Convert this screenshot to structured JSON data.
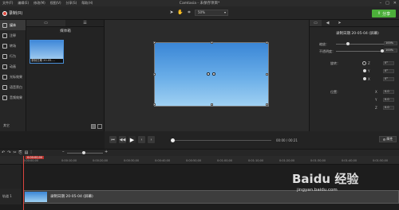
{
  "window": {
    "title": "Camtasia - 未保存项目*",
    "menus": [
      "文件(F)",
      "编辑(E)",
      "修改(M)",
      "视图(V)",
      "分享(S)",
      "帮助(H)"
    ]
  },
  "toolbar": {
    "record_label": "录制(R)",
    "zoom_value": "50%",
    "share_label": "分享"
  },
  "sidebar": {
    "items": [
      {
        "label": "媒体",
        "icon": "media-icon",
        "active": true
      },
      {
        "label": "注释",
        "icon": "annotation-icon"
      },
      {
        "label": "转场",
        "icon": "transition-icon"
      },
      {
        "label": "行为",
        "icon": "behavior-icon"
      },
      {
        "label": "动画",
        "icon": "animation-icon"
      },
      {
        "label": "光标效果",
        "icon": "cursor-effect-icon"
      },
      {
        "label": "语音旁白",
        "icon": "voice-narration-icon"
      },
      {
        "label": "音频效果",
        "icon": "audio-effect-icon"
      }
    ],
    "more_label": "其它"
  },
  "bin": {
    "title": "媒体箱",
    "items": [
      {
        "label": "录制日期 20-05-..."
      }
    ]
  },
  "properties": {
    "clip_title": "录制日期 20-05-04 (屏幕)",
    "scale_label": "缩放：",
    "scale_value": "100%",
    "opacity_label": "不透明度：",
    "opacity_value": "100%",
    "rotation_label": "旋转：",
    "rotation_values": [
      "0°",
      "0°",
      "0°"
    ],
    "rotation_axes": [
      "Z",
      "Y",
      "X"
    ],
    "position_label": "位置：",
    "position_values": [
      "0.0",
      "0.0",
      "0.0"
    ],
    "position_axes": [
      "X",
      "Y",
      "Z"
    ],
    "properties_button": "属性"
  },
  "playback": {
    "timecode": "00:00 / 00:21"
  },
  "timeline": {
    "playhead": "0:00:00;00",
    "ticks": [
      "0:00:00;00",
      "0:00:10;00",
      "0:00:20;00",
      "0:00:30;00",
      "0:00:40;00",
      "0:00:50;00",
      "0:01:00;00",
      "0:01:10;00",
      "0:01:20;00",
      "0:01:30;00",
      "0:01:40;00",
      "0:01:50;00"
    ],
    "track_label": "轨道 1",
    "clip_label": "录制日期 20-05-04 (屏幕)"
  },
  "watermark": {
    "title": "Baidu 经验",
    "url": "jingyan.baidu.com"
  }
}
